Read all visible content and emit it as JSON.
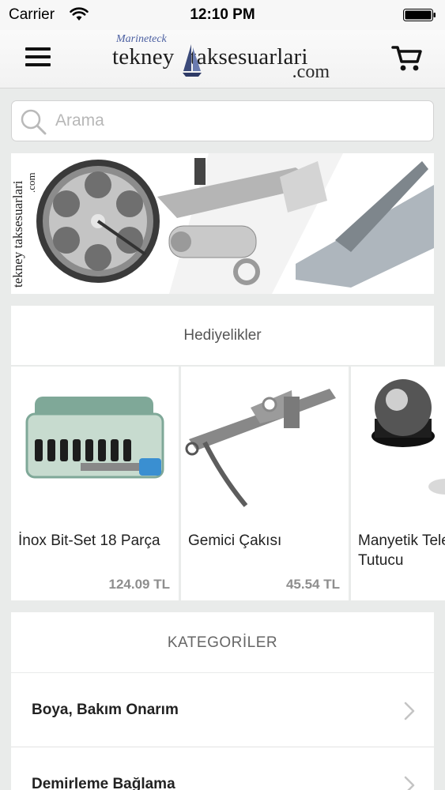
{
  "status_bar": {
    "carrier": "Carrier",
    "time": "12:10 PM"
  },
  "header": {
    "logo_sub": "Marineteck",
    "logo_main_left": "tekney",
    "logo_main_right": "taksesuarlari",
    "logo_domain": ".com",
    "menu_icon": "hamburger-menu-icon",
    "cart_icon": "shopping-cart-icon"
  },
  "search": {
    "placeholder": "Arama",
    "value": ""
  },
  "gifts": {
    "title": "Hediyelikler",
    "products": [
      {
        "name": "İnox Bit-Set 18 Parça",
        "price": "124.09 TL"
      },
      {
        "name": "Gemici Çakısı",
        "price": "45.54 TL"
      },
      {
        "name": "Manyetik Telefon Tutucu",
        "price": ""
      }
    ]
  },
  "categories": {
    "title": "KATEGORİLER",
    "items": [
      {
        "label": "Boya, Bakım Onarım"
      },
      {
        "label": "Demirleme Bağlama"
      }
    ]
  },
  "colors": {
    "accent": "#4b5fa1",
    "price": "#8e8e8e",
    "background": "#e9ebea"
  }
}
